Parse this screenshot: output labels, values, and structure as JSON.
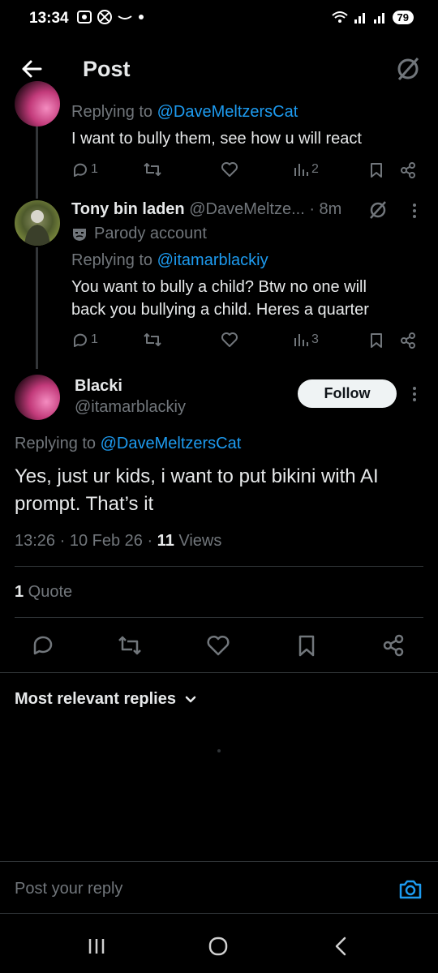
{
  "status_bar": {
    "time": "13:34",
    "battery": "79"
  },
  "header": {
    "title": "Post"
  },
  "reply_one": {
    "replying_label": "Replying to ",
    "replying_handle": "@DaveMeltzersCat",
    "text": "I want to bully them, see how u will react",
    "replies": "1",
    "views": "2"
  },
  "reply_two": {
    "name": "Tony bin laden",
    "handle": "@DaveMeltze...",
    "time": "· 8m",
    "parody_label": "Parody account",
    "replying_label": "Replying to ",
    "replying_handle": "@itamarblackiy",
    "text_line1": "You want to bully a child? Btw no one will",
    "text_line2": "back you bullying a child. Heres a quarter",
    "replies": "1",
    "views": "3"
  },
  "main_post": {
    "name": "Blacki",
    "handle": "@itamarblackiy",
    "follow_label": "Follow",
    "replying_label": "Replying to ",
    "replying_handle": "@DaveMeltzersCat",
    "text_line1": "Yes, just ur kids, i want to put bikini with AI",
    "text_line2": "prompt. That’s it",
    "timestamp": "13:26 · 10 Feb 26 · ",
    "views_count": "11",
    "views_label": " Views",
    "quote_count": "1",
    "quote_label": " Quote"
  },
  "replies_section": {
    "sort_label": "Most relevant replies"
  },
  "composer": {
    "placeholder": "Post your reply"
  },
  "colors": {
    "accent": "#1d9bf0",
    "background": "#000000",
    "text": "#e7e9ea",
    "muted": "#71767b"
  }
}
